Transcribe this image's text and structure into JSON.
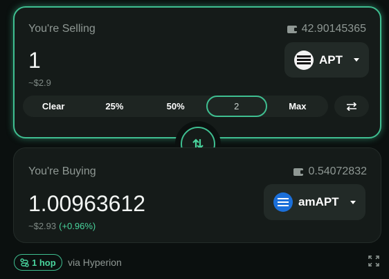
{
  "sell": {
    "title": "You're Selling",
    "balance": "42.90145365",
    "amount": "1",
    "usd": "~$2.9",
    "token": "APT",
    "presets": [
      "Clear",
      "25%",
      "50%",
      "2",
      "Max"
    ]
  },
  "buy": {
    "title": "You're Buying",
    "balance": "0.54072832",
    "amount": "1.00963612",
    "usd": "~$2.93",
    "change": "(+0.96%)",
    "token": "amAPT"
  },
  "route": {
    "hops": "1 hop",
    "via": "via Hyperion"
  },
  "colors": {
    "accent": "#3fbf91",
    "positive": "#49d49d",
    "card": "#151b19"
  },
  "icons": [
    "wallet-icon",
    "chevron-down-icon",
    "swap-icon",
    "flip-icon",
    "route-icon",
    "expand-icon"
  ]
}
